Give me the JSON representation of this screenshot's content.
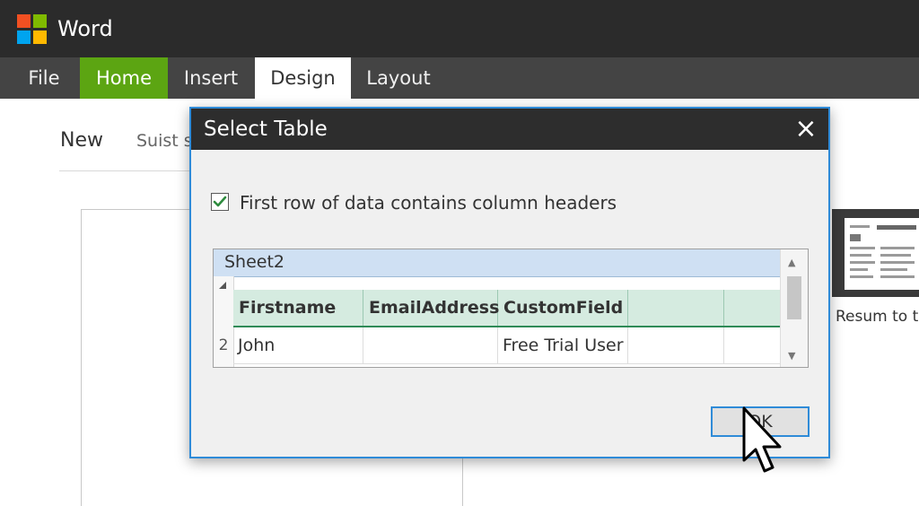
{
  "app": {
    "title": "Word",
    "logo_colors": [
      "#f25022",
      "#7fba00",
      "#00a4ef",
      "#ffb900"
    ]
  },
  "ribbon": {
    "tabs": [
      {
        "label": "File"
      },
      {
        "label": "Home"
      },
      {
        "label": "Insert"
      },
      {
        "label": "Design"
      },
      {
        "label": "Layout"
      }
    ]
  },
  "backstage": {
    "new_label": "New",
    "suist_label": "Suist s",
    "template_caption": "Resum to to"
  },
  "dialog": {
    "title": "Select Table",
    "close_icon": "×",
    "checkbox": {
      "checked": true,
      "label": "First row of data contains column headers"
    },
    "sheet_name": "Sheet2",
    "table": {
      "headers": [
        "Firstname",
        "EmailAddress",
        "CustomField",
        "",
        ""
      ],
      "rows": [
        {
          "num": "2",
          "cells": [
            "John",
            "",
            "Free Trial User",
            "",
            ""
          ]
        }
      ]
    },
    "ok_label": "OK"
  },
  "colors": {
    "accent_blue": "#2f8bd8",
    "home_green": "#5ca512",
    "header_green": "#d5ebe0",
    "sheet_blue": "#cfe0f3"
  }
}
